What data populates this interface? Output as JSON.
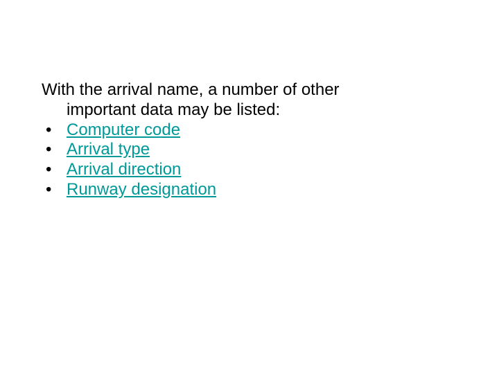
{
  "colors": {
    "link": "#009999"
  },
  "intro": {
    "line1": "With the arrival name, a number of other",
    "line2": "important data may be listed:"
  },
  "items": [
    {
      "label": "Computer code"
    },
    {
      "label": "Arrival type"
    },
    {
      "label": "Arrival direction"
    },
    {
      "label": "Runway designation"
    }
  ]
}
